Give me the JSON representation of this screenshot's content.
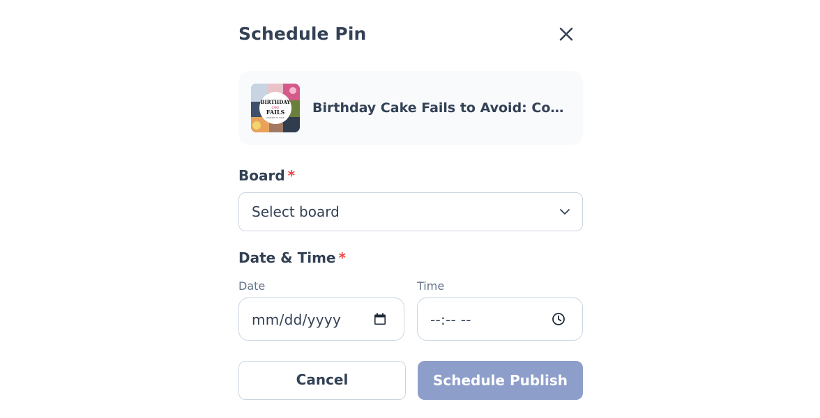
{
  "dialog": {
    "title": "Schedule Pin",
    "close_icon": "close-icon"
  },
  "pin": {
    "title": "Birthday Cake Fails to Avoid: Comm...",
    "thumbnail_text": {
      "line1": "BIRTHDAY",
      "line2": "CAKE",
      "line3": "FAILS",
      "line4": "MISTAKES TO AVOID"
    }
  },
  "board": {
    "label": "Board",
    "required_marker": "*",
    "placeholder": "Select board",
    "chevron_icon": "chevron-down-icon"
  },
  "datetime": {
    "label": "Date & Time",
    "required_marker": "*",
    "date_label": "Date",
    "date_value": "mm/dd/yyyy",
    "date_icon": "calendar-icon",
    "time_label": "Time",
    "time_value": "--:-- --",
    "time_icon": "clock-icon"
  },
  "actions": {
    "cancel_label": "Cancel",
    "publish_label": "Schedule Publish"
  },
  "colors": {
    "text": "#334155",
    "muted": "#64748b",
    "required": "#ef4444",
    "border": "#cbd5e1",
    "card_bg": "#f8fafc",
    "publish_bg": "#8e9ecb"
  }
}
